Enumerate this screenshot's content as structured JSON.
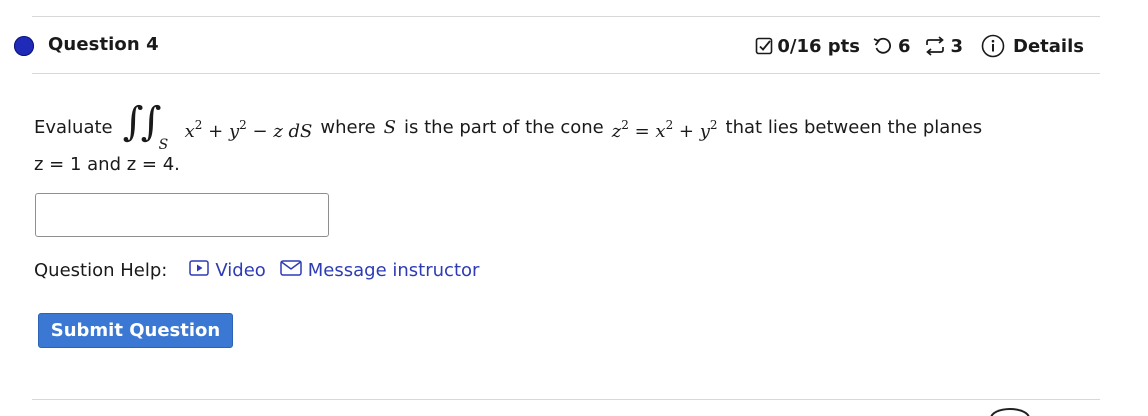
{
  "question": {
    "title": "Question 4",
    "dot_color": "#1f2bb8"
  },
  "meta": {
    "points": "0/16 pts",
    "retries": "6",
    "attempts": "3",
    "details_label": "Details",
    "icons": [
      "checkbox-icon",
      "undo-icon",
      "refresh-icon",
      "info-icon"
    ]
  },
  "problem": {
    "lead": "Evaluate",
    "integral_sub": "S",
    "integrand": "x² + y² − z dS",
    "where_text": "where",
    "S": "S",
    "middle_text": "is the part of the cone",
    "cone_eq": "z² = x² + y²",
    "tail_text": "that lies between the planes",
    "line2": "z = 1 and z = 4."
  },
  "answer": {
    "value": "",
    "placeholder": ""
  },
  "help": {
    "label": "Question Help:",
    "video_label": "Video",
    "message_label": "Message instructor",
    "link_color": "#2d3bb5"
  },
  "submit": {
    "label": "Submit Question",
    "color": "#3b78d4"
  }
}
